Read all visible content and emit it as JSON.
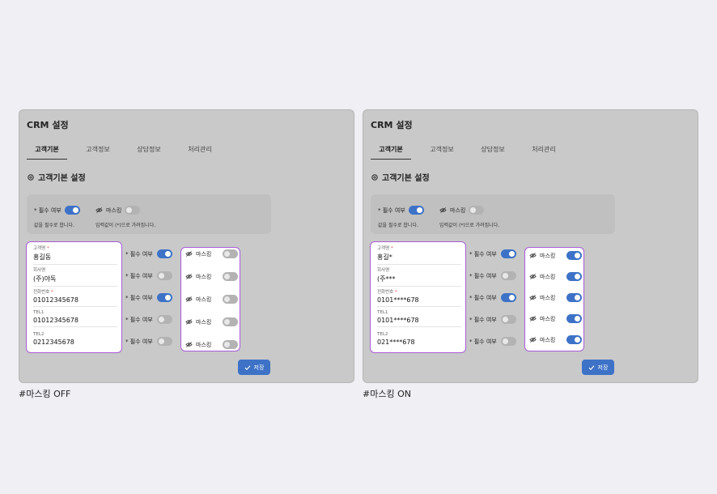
{
  "panels": [
    {
      "title": "CRM 설정",
      "tabs": [
        "고객기본",
        "고객정보",
        "상담정보",
        "처리관리"
      ],
      "active_tab": 0,
      "section_title": "고객기본 설정",
      "legend": {
        "required_label": "* 필수 여부",
        "masking_label": "마스킹",
        "required_desc": "값을 필수로 합니다.",
        "masking_desc": "입력값이 (*)으로 가려집니다.",
        "required_on": true,
        "masking_on": false
      },
      "fields": [
        {
          "label": "고객명",
          "required_mark": "*",
          "value": "홍길동"
        },
        {
          "label": "회사명",
          "required_mark": "",
          "value": "(주)야독"
        },
        {
          "label": "전화번호",
          "required_mark": "*",
          "value": "01012345678"
        },
        {
          "label": "TEL1",
          "required_mark": "",
          "value": "01012345678"
        },
        {
          "label": "TEL2",
          "required_mark": "",
          "value": "0212345678"
        }
      ],
      "required_toggles": [
        {
          "label": "* 필수 여부",
          "on": true
        },
        {
          "label": "* 필수 여부",
          "on": false
        },
        {
          "label": "* 필수 여부",
          "on": true
        },
        {
          "label": "* 필수 여부",
          "on": false
        },
        {
          "label": "* 필수 여부",
          "on": false
        }
      ],
      "mask_toggles": [
        {
          "label": "마스킹",
          "on": false
        },
        {
          "label": "마스킹",
          "on": false
        },
        {
          "label": "마스킹",
          "on": false
        },
        {
          "label": "마스킹",
          "on": false
        },
        {
          "label": "마스킹",
          "on": false
        }
      ],
      "save_label": "저장",
      "caption": "#마스킹 OFF"
    },
    {
      "title": "CRM 설정",
      "tabs": [
        "고객기본",
        "고객정보",
        "상담정보",
        "처리관리"
      ],
      "active_tab": 0,
      "section_title": "고객기본 설정",
      "legend": {
        "required_label": "* 필수 여부",
        "masking_label": "마스킹",
        "required_desc": "값을 필수로 합니다.",
        "masking_desc": "입력값이 (*)으로 가려집니다.",
        "required_on": true,
        "masking_on": false
      },
      "fields": [
        {
          "label": "고객명",
          "required_mark": "*",
          "value": "홍길*"
        },
        {
          "label": "회사명",
          "required_mark": "",
          "value": "(주***"
        },
        {
          "label": "전화번호",
          "required_mark": "*",
          "value": "0101****678"
        },
        {
          "label": "TEL1",
          "required_mark": "",
          "value": "0101****678"
        },
        {
          "label": "TEL2",
          "required_mark": "",
          "value": "021****678"
        }
      ],
      "required_toggles": [
        {
          "label": "* 필수 여부",
          "on": true
        },
        {
          "label": "* 필수 여부",
          "on": false
        },
        {
          "label": "* 필수 여부",
          "on": true
        },
        {
          "label": "* 필수 여부",
          "on": false
        },
        {
          "label": "* 필수 여부",
          "on": false
        }
      ],
      "mask_toggles": [
        {
          "label": "마스킹",
          "on": true
        },
        {
          "label": "마스킹",
          "on": true
        },
        {
          "label": "마스킹",
          "on": true
        },
        {
          "label": "마스킹",
          "on": true
        },
        {
          "label": "마스킹",
          "on": true
        }
      ],
      "save_label": "저장",
      "caption": "#마스킹 ON"
    }
  ],
  "colors": {
    "accent": "#3d72c7",
    "highlight_border": "#a85cd8",
    "required_mark": "#e04848"
  },
  "icons": {
    "section": "gear-icon",
    "masking": "eye-off-icon",
    "save": "check-icon"
  }
}
